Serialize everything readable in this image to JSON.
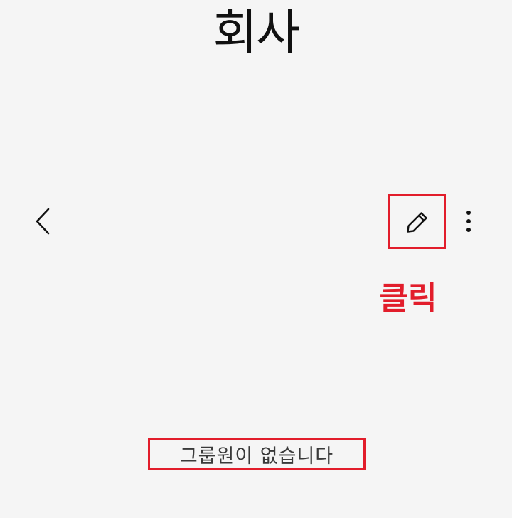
{
  "header": {
    "title": "회사"
  },
  "toolbar": {
    "back_icon": "chevron-left-icon",
    "edit_icon": "pencil-icon",
    "more_icon": "more-vertical-icon"
  },
  "annotation": {
    "click_label": "클릭",
    "highlight_color": "#e21d2b"
  },
  "members": {
    "empty_message": "그룹원이 없습니다"
  }
}
